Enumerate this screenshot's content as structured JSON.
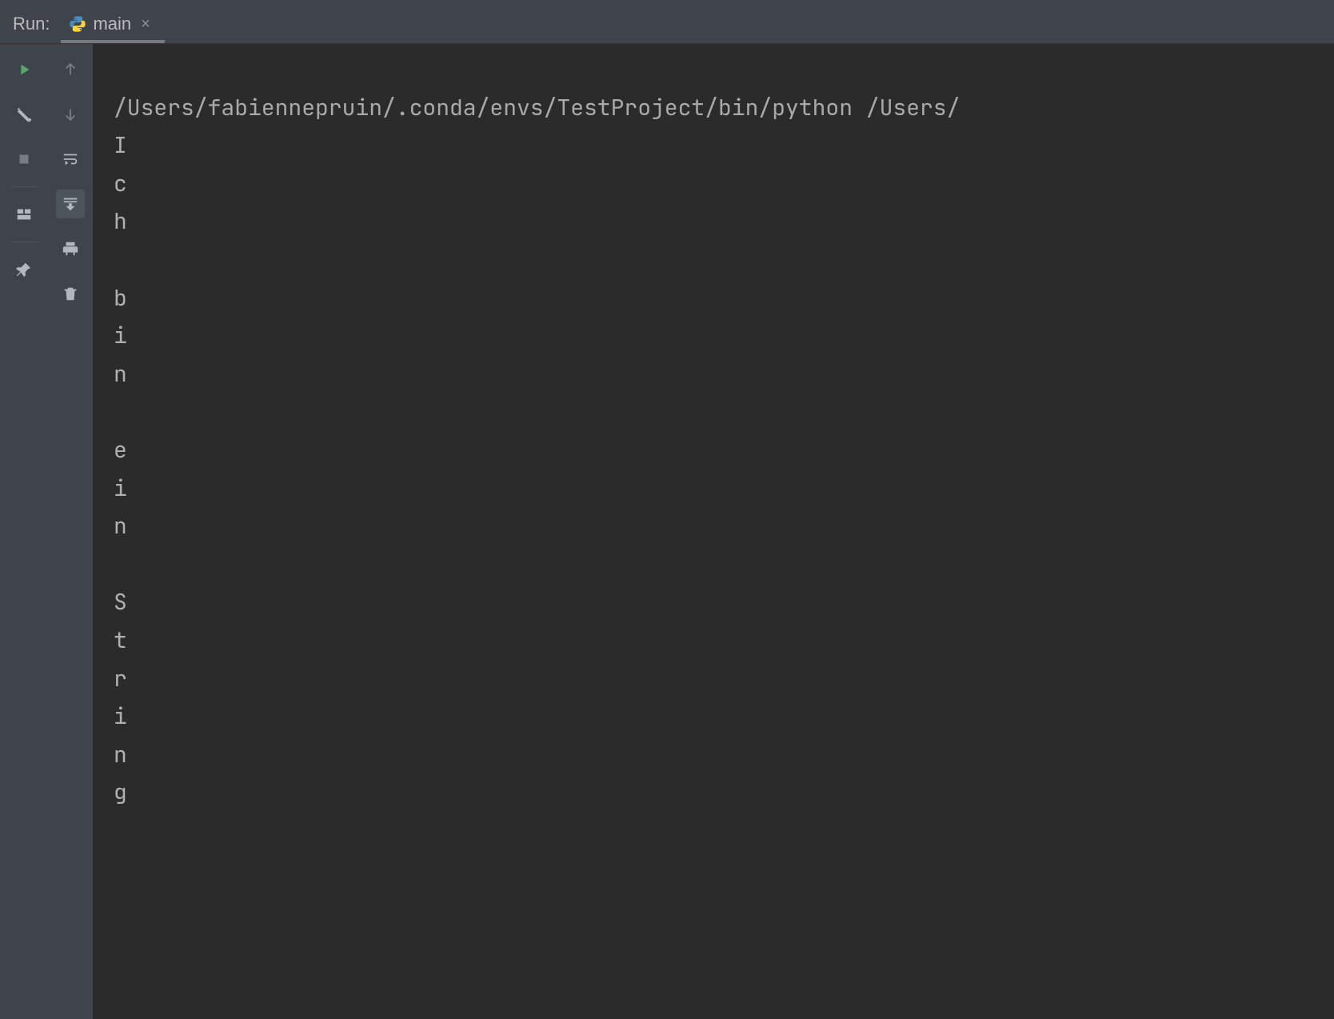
{
  "header": {
    "run_label": "Run:",
    "tab_name": "main"
  },
  "toolbar_a": {
    "rerun_title": "Rerun",
    "modify_run_config_title": "Modify Run Configuration",
    "stop_title": "Stop",
    "layout_title": "Layout",
    "pin_title": "Pin Tab"
  },
  "toolbar_b": {
    "up_title": "Up the Stack Trace",
    "down_title": "Down the Stack Trace",
    "soft_wrap_title": "Soft-Wrap",
    "scroll_end_title": "Scroll to End",
    "print_title": "Print",
    "clear_title": "Clear All"
  },
  "console": {
    "command": "/Users/fabiennepruin/.conda/envs/TestProject/bin/python /Users/",
    "output": "I\nc\nh\n\nb\ni\nn\n\ne\ni\nn\n\nS\nt\nr\ni\nn\ng"
  }
}
